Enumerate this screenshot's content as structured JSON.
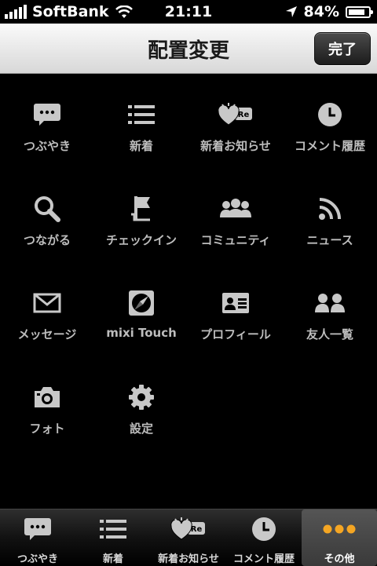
{
  "status": {
    "carrier": "SoftBank",
    "time": "21:11",
    "battery": "84%",
    "battery_level": 0.84
  },
  "nav": {
    "title": "配置変更",
    "done": "完了"
  },
  "grid": {
    "items": [
      {
        "label": "つぶやき",
        "icon": "speech-bubble-icon"
      },
      {
        "label": "新着",
        "icon": "list-icon"
      },
      {
        "label": "新着お知らせ",
        "icon": "heart-reply-icon"
      },
      {
        "label": "コメント履歴",
        "icon": "clock-icon"
      },
      {
        "label": "つながる",
        "icon": "search-icon"
      },
      {
        "label": "チェックイン",
        "icon": "flag-icon"
      },
      {
        "label": "コミュニティ",
        "icon": "community-icon"
      },
      {
        "label": "ニュース",
        "icon": "rss-icon"
      },
      {
        "label": "メッセージ",
        "icon": "envelope-icon"
      },
      {
        "label": "mixi Touch",
        "icon": "compass-icon"
      },
      {
        "label": "プロフィール",
        "icon": "profile-card-icon"
      },
      {
        "label": "友人一覧",
        "icon": "friends-icon"
      },
      {
        "label": "フォト",
        "icon": "camera-icon"
      },
      {
        "label": "設定",
        "icon": "gear-icon"
      }
    ]
  },
  "tabs": {
    "items": [
      {
        "label": "つぶやき",
        "icon": "speech-bubble-icon"
      },
      {
        "label": "新着",
        "icon": "list-icon"
      },
      {
        "label": "新着お知らせ",
        "icon": "heart-reply-icon"
      },
      {
        "label": "コメント履歴",
        "icon": "clock-icon"
      },
      {
        "label": "その他",
        "icon": "more-dots-icon"
      }
    ]
  },
  "colors": {
    "active_accent": "#f5a623",
    "icon": "#c8c8c8"
  }
}
